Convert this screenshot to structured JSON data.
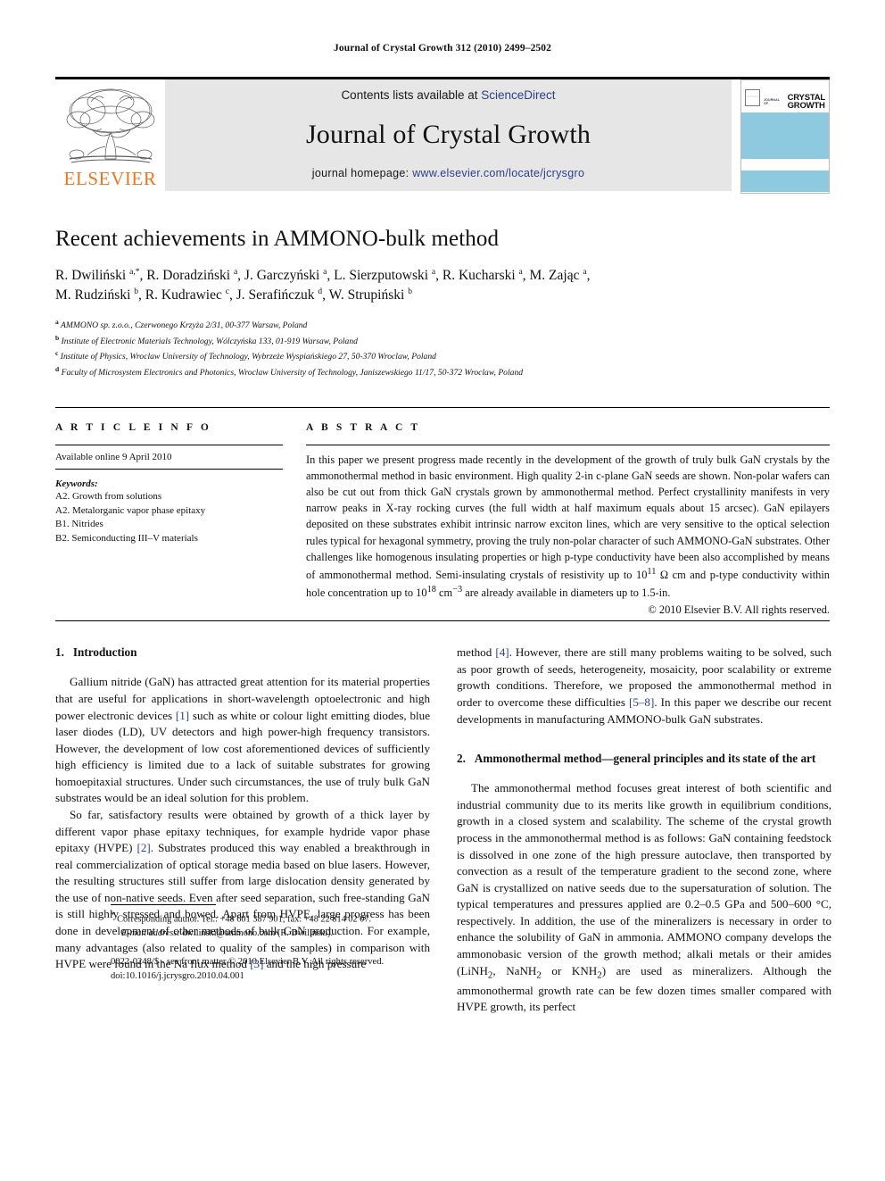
{
  "running_head": "Journal of Crystal Growth 312 (2010) 2499–2502",
  "masthead": {
    "contents_prefix": "Contents lists available at ",
    "contents_link": "ScienceDirect",
    "journal_title": "Journal of Crystal Growth",
    "homepage_prefix": "journal homepage: ",
    "homepage_url": "www.elsevier.com/locate/jcrysgro",
    "publisher_name": "ELSEVIER",
    "cover": {
      "journal_of_label": "JOURNAL OF",
      "title_line1": "CRYSTAL",
      "title_line2": "GROWTH"
    }
  },
  "article": {
    "title": "Recent achievements in AMMONO-bulk method",
    "authors_line1": "R. Dwiliński <sup>a,*</sup>, R. Doradziński <sup>a</sup>, J. Garczyński <sup>a</sup>, L. Sierzputowski <sup>a</sup>, R. Kucharski <sup>a</sup>, M. Zając <sup>a</sup>,",
    "authors_line2": "M. Rudziński <sup>b</sup>, R. Kudrawiec <sup>c</sup>, J. Serafińczuk <sup>d</sup>, W. Strupiński <sup>b</sup>",
    "affiliations": [
      {
        "mark": "a",
        "text": "AMMONO sp. z.o.o., Czerwonego Krzyża 2/31, 00-377 Warsaw, Poland"
      },
      {
        "mark": "b",
        "text": "Institute of Electronic Materials Technology, Wólczyńska 133, 01-919 Warsaw, Poland"
      },
      {
        "mark": "c",
        "text": "Institute of Physics, Wroclaw University of Technology, Wybrzeże Wyspiańskiego 27, 50-370 Wroclaw, Poland"
      },
      {
        "mark": "d",
        "text": "Faculty of Microsystem Electronics and Photonics, Wroclaw University of Technology, Janiszewskiego 11/17, 50-372 Wroclaw, Poland"
      }
    ]
  },
  "article_info": {
    "heading": "A R T I C L E   I N F O",
    "history": "Available online 9 April 2010",
    "keywords_label": "Keywords:",
    "keywords": [
      "A2. Growth from solutions",
      "A2. Metalorganic vapor phase epitaxy",
      "B1. Nitrides",
      "B2. Semiconducting III–V materials"
    ]
  },
  "abstract": {
    "heading": "A B S T R A C T",
    "text": "In this paper we present progress made recently in the development of the growth of truly bulk GaN crystals by the ammonothermal method in basic environment. High quality 2-in c-plane GaN seeds are shown. Non-polar wafers can also be cut out from thick GaN crystals grown by ammonothermal method. Perfect crystallinity manifests in very narrow peaks in X-ray rocking curves (the full width at half maximum equals about 15 arcsec). GaN epilayers deposited on these substrates exhibit intrinsic narrow exciton lines, which are very sensitive to the optical selection rules typical for hexagonal symmetry, proving the truly non-polar character of such AMMONO-GaN substrates. Other challenges like homogenous insulating properties or high p-type conductivity have been also accomplished by means of ammonothermal method. Semi-insulating crystals of resistivity up to 10<sup>11</sup> Ω cm and p-type conductivity within hole concentration up to 10<sup>18</sup> cm<sup>−3</sup> are already available in diameters up to 1.5-in.",
    "copyright": "© 2010 Elsevier B.V. All rights reserved."
  },
  "body": {
    "section1": {
      "number": "1.",
      "title": "Introduction",
      "paragraphs": [
        "Gallium nitride (GaN) has attracted great attention for its material properties that are useful for applications in short-wavelength optoelectronic and high power electronic devices <span class=\"ref\">[1]</span> such as white or colour light emitting diodes, blue laser diodes (LD), UV detectors and high power-high frequency transistors. However, the development of low cost aforementioned devices of sufficiently high efficiency is limited due to a lack of suitable substrates for growing homoepitaxial structures. Under such circumstances, the use of truly bulk GaN substrates would be an ideal solution for this problem.",
        "So far, satisfactory results were obtained by growth of a thick layer by different vapor phase epitaxy techniques, for example hydride vapor phase epitaxy (HVPE) <span class=\"ref\">[2]</span>. Substrates produced this way enabled a breakthrough in real commercialization of optical storage media based on blue lasers. However, the resulting structures still suffer from large dislocation density generated by the use of non-native seeds. Even after seed separation, such free-standing GaN is still highly stressed and bowed. Apart from HVPE, large progress has been done in development of other methods of bulk GaN production. For example, many advantages (also related to quality of the samples) in comparison with HVPE were found in the Na flux method <span class=\"ref\">[3]</span> and the high pressure"
      ]
    },
    "right_column_continuation": "method <span class=\"ref\">[4]</span>. However, there are still many problems waiting to be solved, such as poor growth of seeds, heterogeneity, mosaicity, poor scalability or extreme growth conditions. Therefore, we proposed the ammonothermal method in order to overcome these difficulties <span class=\"ref\">[5–8]</span>. In this paper we describe our recent developments in manufacturing AMMONO-bulk GaN substrates.",
    "section2": {
      "number": "2.",
      "title": "Ammonothermal method—general principles and its state of the art",
      "paragraphs": [
        "The ammonothermal method focuses great interest of both scientific and industrial community due to its merits like growth in equilibrium conditions, growth in a closed system and scalability. The scheme of the crystal growth process in the ammonothermal method is as follows: GaN containing feedstock is dissolved in one zone of the high pressure autoclave, then transported by convection as a result of the temperature gradient to the second zone, where GaN is crystallized on native seeds due to the supersaturation of solution. The typical temperatures and pressures applied are 0.2–0.5 GPa and 500–600 °C, respectively. In addition, the use of the mineralizers is necessary in order to enhance the solubility of GaN in ammonia. AMMONO company develops the ammonobasic version of the growth method; alkali metals or their amides (LiNH<sub>2</sub>, NaNH<sub>2</sub> or KNH<sub>2</sub>) are used as mineralizers. Although the ammonothermal growth rate can be few dozen times smaller compared with HVPE growth, its perfect"
      ]
    }
  },
  "footnotes": {
    "corresponding": "<sup>*</sup> Corresponding author. Tel.: +48 601 387 901; fax: +48 22 814 02 07.",
    "email_label": "E-mail address:",
    "email": "dwilinski@ammono.com (R. Dwiliński).",
    "issn_line": "0022-0248/$ - see front matter © 2010 Elsevier B.V. All rights reserved.",
    "doi_line": "doi:10.1016/j.jcrysgro.2010.04.001"
  },
  "colors": {
    "link_blue": "#2b3f8c",
    "elsevier_orange": "#E87722",
    "cover_blue": "#8ecadf",
    "band_grey": "#e6e6e6"
  }
}
